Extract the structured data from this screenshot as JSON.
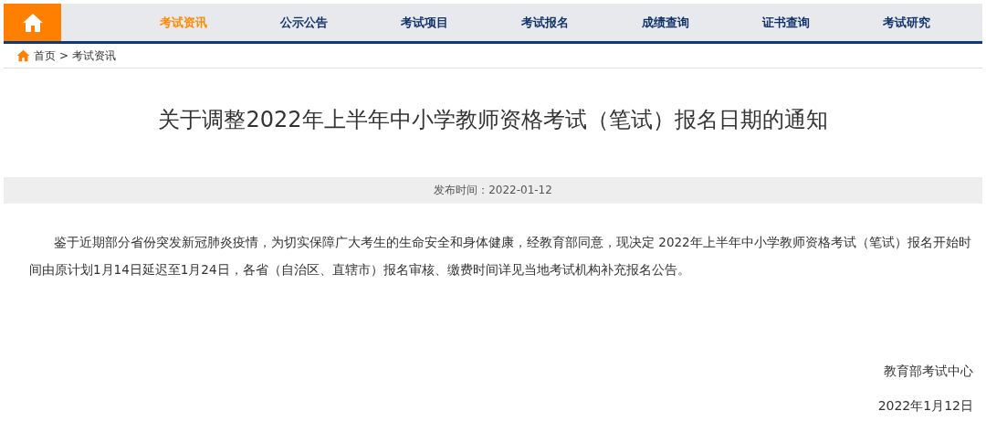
{
  "nav": {
    "items": [
      {
        "label": "考试资讯",
        "selected": true
      },
      {
        "label": "公示公告",
        "selected": false
      },
      {
        "label": "考试项目",
        "selected": false
      },
      {
        "label": "考试报名",
        "selected": false
      },
      {
        "label": "成绩查询",
        "selected": false
      },
      {
        "label": "证书查询",
        "selected": false
      },
      {
        "label": "考试研究",
        "selected": false
      }
    ]
  },
  "breadcrumb": [
    "首页",
    ">",
    "考试资讯"
  ],
  "article": {
    "title": "关于调整2022年上半年中小学教师资格考试（笔试）报名日期的通知",
    "published": "发布时间：2022-01-12",
    "body": "鉴于近期部分省份突发新冠肺炎疫情，为切实保障广大考生的生命安全和身体健康，经教育部同意，现决定 2022年上半年中小学教师资格考试（笔试）报名开始时间由原计划1月14日延迟至1月24日，各省（自治区、直辖市）报名审核、缴费时间详见当地考试机构补充报名公告。",
    "signature": "教育部考试中心",
    "date": "2022年1月12日"
  }
}
